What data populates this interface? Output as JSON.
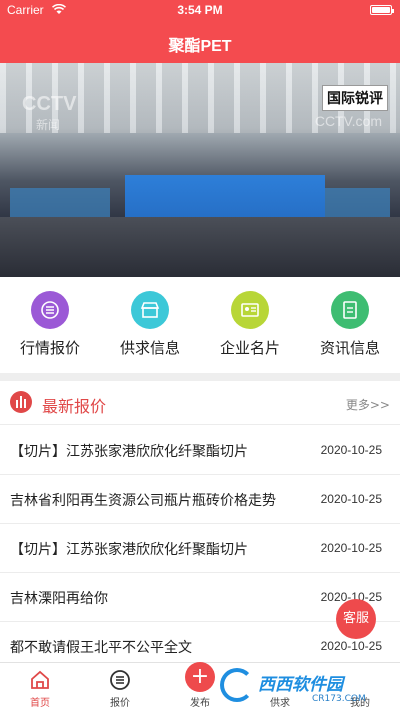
{
  "status_bar": {
    "carrier": "Carrier",
    "time": "3:54 PM"
  },
  "header": {
    "title": "聚酯PET"
  },
  "banner": {
    "channel_logo": "CCTV",
    "channel_sub": "新闻",
    "channel_logo_right": "CCTV.com",
    "stamp_text": "国际锐评"
  },
  "quick_menu": [
    {
      "label": "行情报价",
      "icon": "list-icon",
      "color": "#9b59d6"
    },
    {
      "label": "供求信息",
      "icon": "store-icon",
      "color": "#3cc8d8"
    },
    {
      "label": "企业名片",
      "icon": "card-icon",
      "color": "#b8d637"
    },
    {
      "label": "资讯信息",
      "icon": "document-icon",
      "color": "#3ebd72"
    }
  ],
  "latest": {
    "title": "最新报价",
    "more_label": "更多>>",
    "items": [
      {
        "title": "【切片】江苏张家港欣欣化纤聚酯切片",
        "date": "2020-10-25"
      },
      {
        "title": "吉林省利阳再生资源公司瓶片瓶砖价格走势",
        "date": "2020-10-25"
      },
      {
        "title": "【切片】江苏张家港欣欣化纤聚酯切片",
        "date": "2020-10-25"
      },
      {
        "title": "吉林溧阳再给你",
        "date": "2020-10-25"
      },
      {
        "title": "都不敢请假王北平不公平全文",
        "date": "2020-10-25"
      }
    ]
  },
  "customer_service": {
    "label": "客服"
  },
  "tabbar": {
    "tabs": [
      {
        "label": "首页",
        "icon": "home-icon",
        "active": true
      },
      {
        "label": "报价",
        "icon": "menu-icon",
        "active": false
      },
      {
        "label": "发布",
        "icon": "plus-icon",
        "active": false
      },
      {
        "label": "供求",
        "icon": "store-icon",
        "active": false
      },
      {
        "label": "我的",
        "icon": "user-icon",
        "active": false
      }
    ]
  },
  "watermark": {
    "text": "西西软件园",
    "sub": "CR173.COM"
  },
  "colors": {
    "brand": "#f44b4f",
    "accent": "#e04848"
  }
}
